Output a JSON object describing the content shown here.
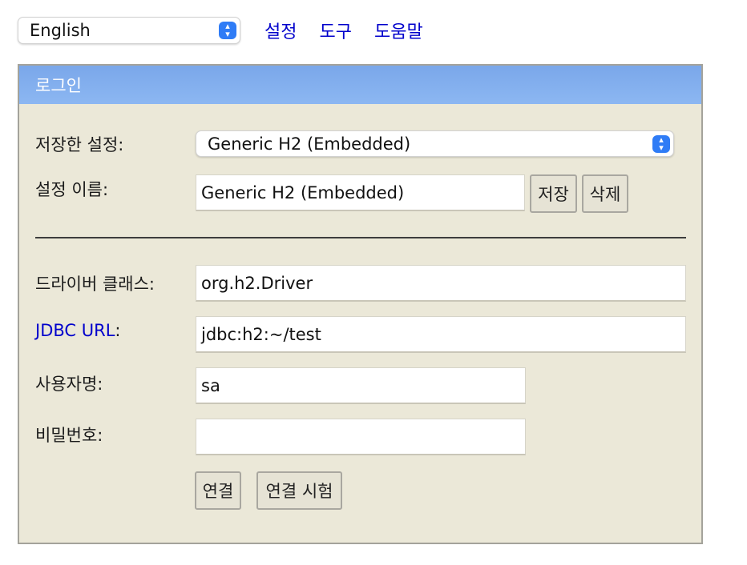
{
  "top": {
    "language_value": "English",
    "links": [
      "설정",
      "도구",
      "도움말"
    ]
  },
  "panel": {
    "title": "로그인",
    "saved_settings": {
      "label": "저장한 설정:",
      "value": "Generic H2 (Embedded)"
    },
    "setting_name": {
      "label": "설정 이름:",
      "value": "Generic H2 (Embedded)"
    },
    "save_label": "저장",
    "delete_label": "삭제",
    "driver_class": {
      "label": "드라이버 클래스:",
      "value": "org.h2.Driver"
    },
    "jdbc_url": {
      "label": "JDBC URL",
      "colon": ":",
      "value": "jdbc:h2:~/test"
    },
    "username": {
      "label": "사용자명:",
      "value": "sa"
    },
    "password": {
      "label": "비밀번호:",
      "value": ""
    },
    "connect_label": "연결",
    "test_connection_label": "연결 시험"
  },
  "colors": {
    "header_gradient": "#8cb7f2",
    "panel_bg": "#ebe8d8",
    "link": "#0000cc",
    "select_accent": "#2f7cf6"
  }
}
